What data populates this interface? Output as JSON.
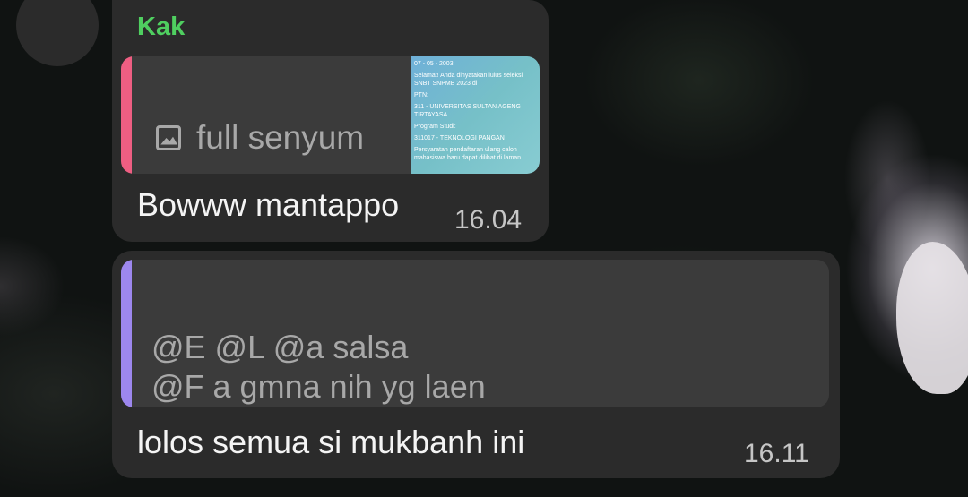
{
  "messages": [
    {
      "sender": "Kak",
      "reply": {
        "preview_text": "full senyum",
        "preview_icon": "image-icon",
        "thumbnail_lines": [
          "07 - 05 - 2003",
          "Selamat! Anda dinyatakan lulus seleksi SNBT SNPMB 2023 di",
          "PTN:",
          "311 - UNIVERSITAS SULTAN AGENG TIRTAYASA",
          "Program Studi:",
          "311017 - TEKNOLOGI PANGAN",
          "Persyaratan pendaftaran ulang calon mahasiswa baru dapat dilihat di laman"
        ]
      },
      "text": "Bowww mantappo",
      "time": "16.04"
    },
    {
      "reply": {
        "lines": [
          "@E          @L          @a          salsa",
          "@F                a gmna nih yg laen"
        ]
      },
      "text": "lolos semua si mukbanh ini",
      "time": "16.11"
    }
  ],
  "colors": {
    "sender_name": "#4fcf60",
    "reply_bar_1": "#ee5e82",
    "reply_bar_2": "#9d87ee",
    "bubble": "#2b2b2b",
    "reply_bg": "#3b3b3b"
  }
}
